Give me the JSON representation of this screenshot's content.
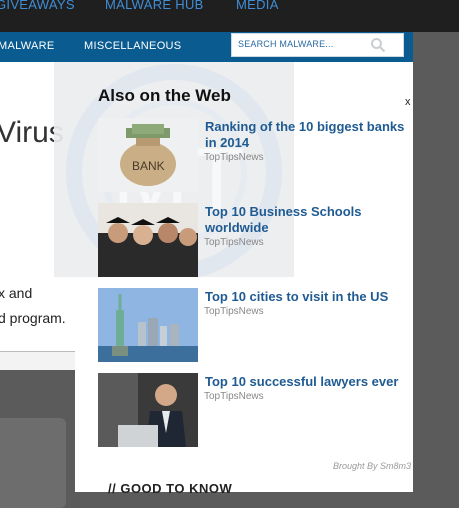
{
  "top_nav": [
    "GIVEAWAYS",
    "MALWARE HUB",
    "MEDIA"
  ],
  "main_nav": [
    "MALWARE",
    "MISCELLANEOUS"
  ],
  "search": {
    "placeholder": "SEARCH MALWARE..."
  },
  "article": {
    "title_fragment": "Virus",
    "line1": "x and",
    "line2": "d program."
  },
  "widget": {
    "title": "Also on the Web",
    "close_label": "x",
    "items": [
      {
        "title": "Ranking of the 10 biggest banks in 2014",
        "source": "TopTipsNews",
        "image": "bank-moneybag"
      },
      {
        "title": "Top 10 Business Schools worldwide",
        "source": "TopTipsNews",
        "image": "graduates"
      },
      {
        "title": "Top 10 cities to visit in the US",
        "source": "TopTipsNews",
        "image": "statue-of-liberty"
      },
      {
        "title": "Top 10 successful lawyers ever",
        "source": "TopTipsNews",
        "image": "businessman"
      }
    ],
    "credit": "Brought By Sm8m3"
  },
  "section_heading": "// GOOD TO KNOW",
  "colors": {
    "nav_blue": "#0a5b8f",
    "link_blue": "#1f5b92",
    "top_nav_text": "#3f8ed6"
  }
}
